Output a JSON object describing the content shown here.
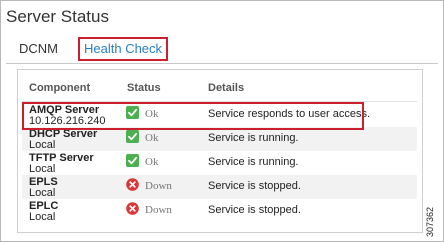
{
  "page": {
    "title": "Server Status"
  },
  "tabs": [
    {
      "label": "DCNM"
    },
    {
      "label": "Health Check",
      "highlighted": true
    }
  ],
  "table": {
    "headers": [
      "Component",
      "Status",
      "Details"
    ],
    "rows": [
      {
        "name": "AMQP Server",
        "sub": "10.126.216.240",
        "status": "Ok",
        "status_icon": "check-icon",
        "details": "Service responds to user access.",
        "highlighted": true
      },
      {
        "name": "DHCP Server",
        "sub": "Local",
        "status": "Ok",
        "status_icon": "check-icon",
        "details": "Service is running."
      },
      {
        "name": "TFTP Server",
        "sub": "Local",
        "status": "Ok",
        "status_icon": "check-icon",
        "details": "Service is running."
      },
      {
        "name": "EPLS",
        "sub": "Local",
        "status": "Down",
        "status_icon": "x-circle-icon",
        "details": "Service is stopped."
      },
      {
        "name": "EPLC",
        "sub": "Local",
        "status": "Down",
        "status_icon": "x-circle-icon",
        "details": "Service is stopped."
      }
    ]
  },
  "colors": {
    "ok": "#4caf50",
    "down": "#d9383a",
    "link": "#2a7fbf",
    "highlight_box": "#cc1f2d"
  },
  "figure_id": "307362"
}
